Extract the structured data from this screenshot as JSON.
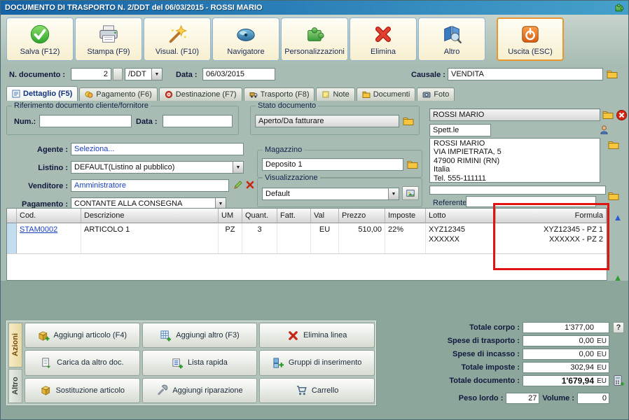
{
  "colors": {
    "annotation-red": "#e11414",
    "link-blue": "#1a3fbd",
    "exit-orange": "#e8962e",
    "title-grad-a": "#1563a6",
    "title-grad-b": "#45a0ca"
  },
  "window": {
    "title": "DOCUMENTO DI TRASPORTO N. 2/DDT del 06/03/2015 - ROSSI MARIO"
  },
  "toolbar": {
    "buttons": [
      {
        "label": "Salva (F12)",
        "icon": "green-check-icon"
      },
      {
        "label": "Stampa (F9)",
        "icon": "printer-icon"
      },
      {
        "label": "Visual. (F10)",
        "icon": "magic-wand-icon"
      },
      {
        "label": "Navigatore",
        "icon": "navigator-icon"
      },
      {
        "label": "Personalizzazioni",
        "icon": "puzzle-icon"
      },
      {
        "label": "Elimina",
        "icon": "red-x-icon"
      },
      {
        "label": "Altro",
        "icon": "book-search-icon"
      },
      {
        "label": "Uscita (ESC)",
        "icon": "power-icon"
      }
    ]
  },
  "doc_header": {
    "n_label": "N. documento :",
    "n_value": "2",
    "type_value": "/DDT",
    "date_label": "Data :",
    "date_value": "06/03/2015",
    "causale_label": "Causale :",
    "causale_value": "VENDITA"
  },
  "tabs": [
    {
      "label": "Dettaglio (F5)"
    },
    {
      "label": "Pagamento (F6)"
    },
    {
      "label": "Destinazione (F7)"
    },
    {
      "label": "Trasporto (F8)"
    },
    {
      "label": "Note"
    },
    {
      "label": "Documenti"
    },
    {
      "label": "Foto"
    }
  ],
  "detail": {
    "riferimento_title": "Riferimento documento cliente/fornitore",
    "num_label": "Num.:",
    "num_value": "",
    "data_label": "Data :",
    "data_value": "",
    "agente_label": "Agente :",
    "agente_value": "Seleziona...",
    "listino_label": "Listino :",
    "listino_value": "DEFAULT(Listino al pubblico)",
    "venditore_label": "Venditore :",
    "venditore_value": "Amministratore",
    "pagamento_label": "Pagamento :",
    "pagamento_value": "CONTANTE ALLA CONSEGNA",
    "stato_title": "Stato documento",
    "stato_value": "Aperto/Da fatturare",
    "magazzino_title": "Magazzino",
    "magazzino_value": "Deposito 1",
    "visualizzazione_title": "Visualizzazione",
    "visualizzazione_value": "Default",
    "customer": {
      "name": "ROSSI MARIO",
      "salutation": "Spett.le",
      "address": [
        "ROSSI MARIO",
        "VIA IMPIETRATA, 5",
        "47900 RIMINI (RN)",
        "Italia",
        "Tel. 555-111111"
      ],
      "extra_value": "",
      "referente_label": "Referente",
      "referente_value": ""
    }
  },
  "grid": {
    "columns": [
      "Cod.",
      "Descrizione",
      "UM",
      "Quant.",
      "Fatt.",
      "Val",
      "Prezzo",
      "Imposte",
      "Lotto",
      "Formula"
    ],
    "rows": [
      {
        "cod": "STAM0002",
        "descrizione": "ARTICOLO 1",
        "um": "PZ",
        "quant": "3",
        "fatt": "",
        "val": "EU",
        "prezzo": "510,00",
        "imposte": "22%",
        "lotto": [
          "XYZ12345",
          "XXXXXX"
        ],
        "formula": [
          "XYZ12345 - PZ 1",
          "XXXXXX - PZ 2"
        ]
      }
    ]
  },
  "actions": {
    "tabs": [
      {
        "label": "Azioni"
      },
      {
        "label": "Altro"
      }
    ],
    "buttons": [
      {
        "label": "Aggiungi articolo (F4)"
      },
      {
        "label": "Aggiungi altro (F3)"
      },
      {
        "label": "Elimina linea"
      },
      {
        "label": "Carica da altro doc."
      },
      {
        "label": "Lista rapida"
      },
      {
        "label": "Gruppi di inserimento"
      },
      {
        "label": "Sostituzione articolo"
      },
      {
        "label": "Aggiungi riparazione"
      },
      {
        "label": "Carrello"
      }
    ]
  },
  "totals": {
    "rows": [
      {
        "label": "Totale corpo :",
        "value": "1'377,00",
        "suffix": ""
      },
      {
        "label": "Spese di trasporto :",
        "value": "0,00",
        "suffix": "EU"
      },
      {
        "label": "Spese di incasso :",
        "value": "0,00",
        "suffix": "EU"
      },
      {
        "label": "Totale imposte :",
        "value": "302,94",
        "suffix": "EU"
      },
      {
        "label": "Totale documento :",
        "value": "1'679,94",
        "suffix": "EU"
      }
    ],
    "help_label": "?",
    "peso_label": "Peso lordo :",
    "peso_value": "27",
    "volume_label": "Volume :",
    "volume_value": "0"
  }
}
